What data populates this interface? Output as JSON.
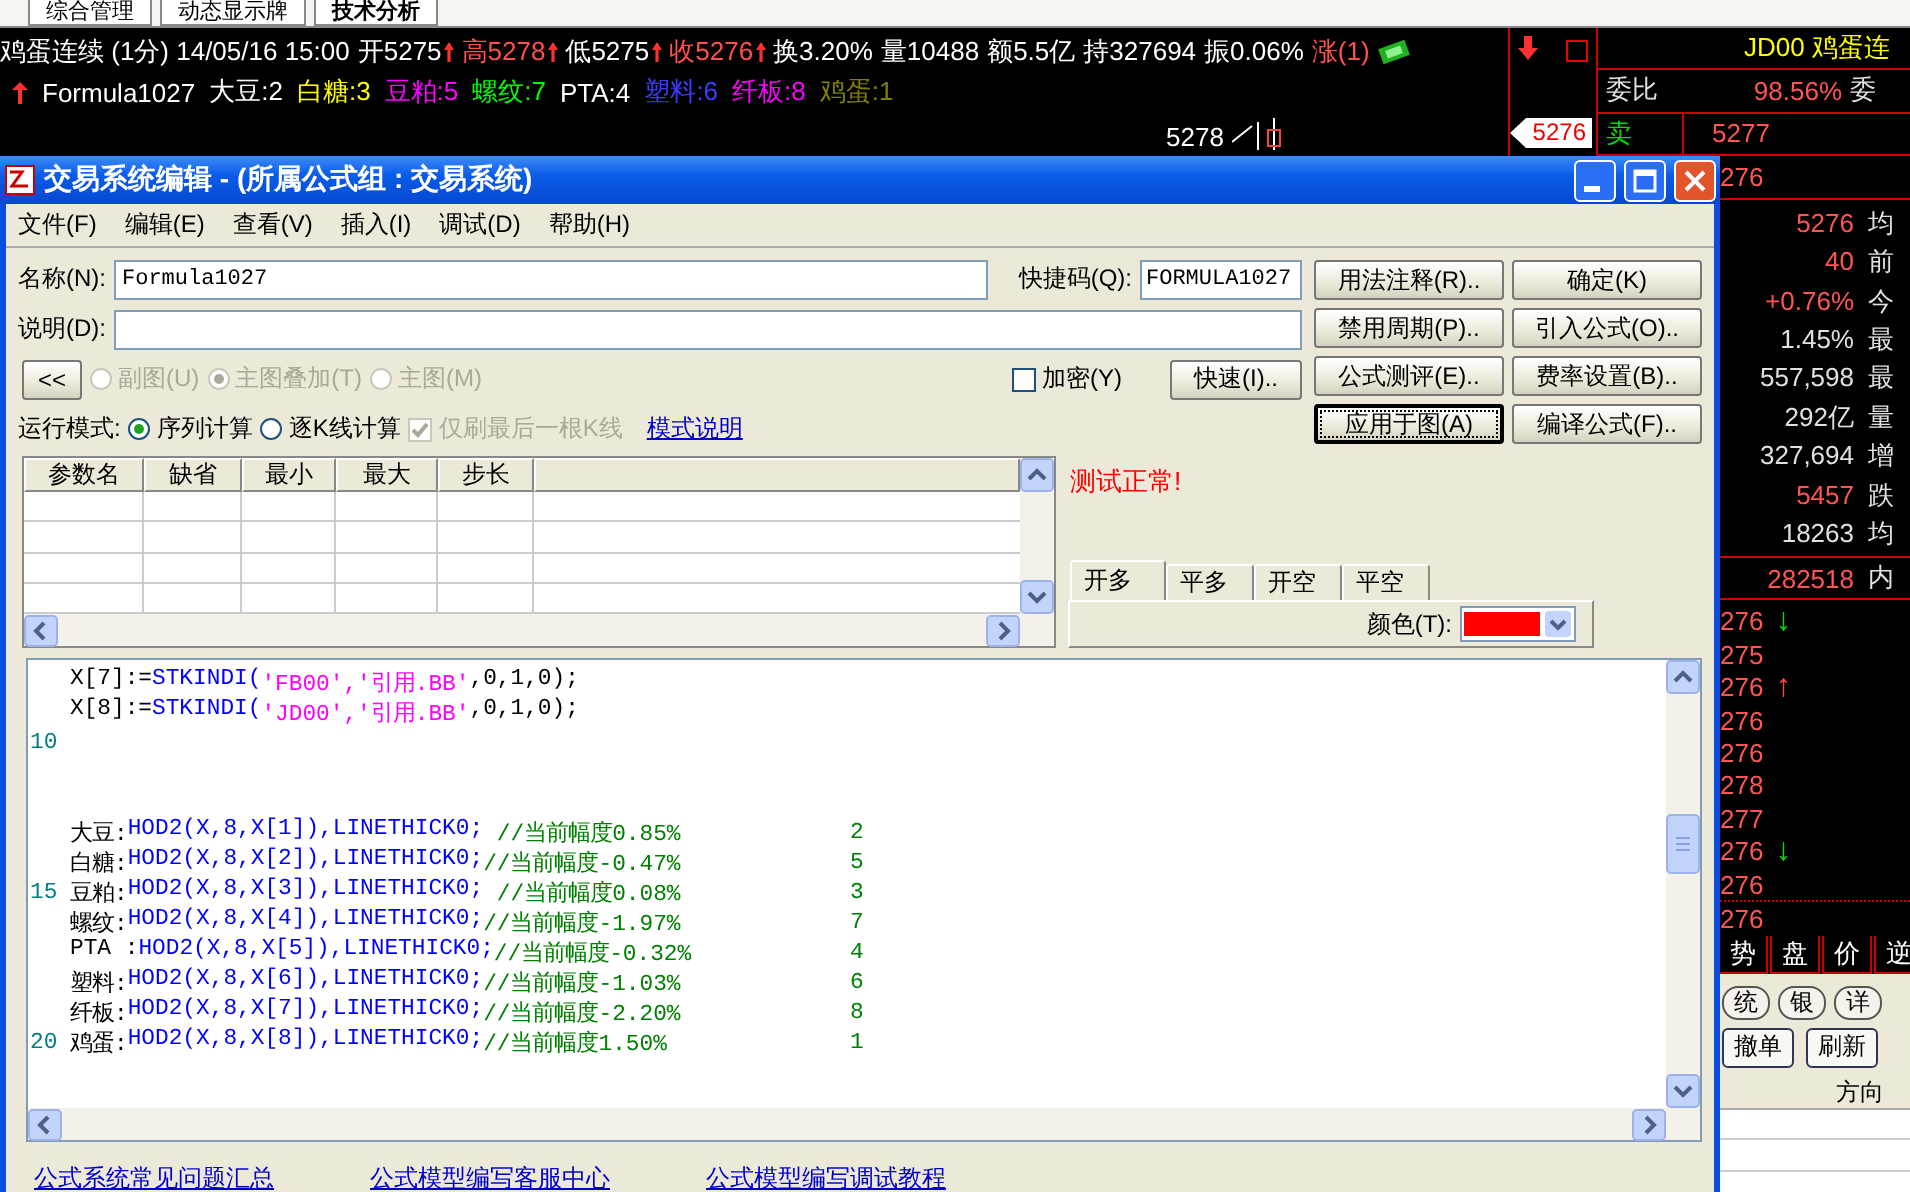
{
  "app_tabs": [
    {
      "label": "综合管理",
      "selected": false
    },
    {
      "label": "动态显示牌",
      "selected": false
    },
    {
      "label": "技术分析",
      "selected": true
    }
  ],
  "quote_line": [
    {
      "text": "鸡蛋连续 (1分) 14/05/16 15:00",
      "color": "#ffffff",
      "marker": false
    },
    {
      "text": "开5275",
      "color": "#ffffff",
      "marker": true
    },
    {
      "text": "高5278",
      "color": "#ff5050",
      "marker": true
    },
    {
      "text": "低5275",
      "color": "#ffffff",
      "marker": true
    },
    {
      "text": "收5276",
      "color": "#ff5050",
      "marker": true
    },
    {
      "text": "换3.20%",
      "color": "#ffffff",
      "marker": false
    },
    {
      "text": "量10488",
      "color": "#ffffff",
      "marker": false
    },
    {
      "text": "额5.5亿",
      "color": "#ffffff",
      "marker": false
    },
    {
      "text": "持327694",
      "color": "#ffffff",
      "marker": false
    },
    {
      "text": "振0.06%",
      "color": "#ffffff",
      "marker": false
    },
    {
      "text": "涨(1)",
      "color": "#ff5050",
      "marker": false
    }
  ],
  "legend": {
    "formula": "Formula1027",
    "items": [
      {
        "text": "大豆:2",
        "color": "#ffffff"
      },
      {
        "text": "白糖:3",
        "color": "#ffff00"
      },
      {
        "text": "豆粕:5",
        "color": "#ff00ff"
      },
      {
        "text": "螺纹:7",
        "color": "#00ff00"
      },
      {
        "text": "PTA:4",
        "color": "#ffffff"
      },
      {
        "text": "塑料:6",
        "color": "#3c3cff"
      },
      {
        "text": "纤板:8",
        "color": "#ff00ff"
      },
      {
        "text": "鸡蛋:1",
        "color": "#808000"
      }
    ]
  },
  "chart": {
    "price_label": "5278",
    "axis_tag": "5276"
  },
  "side_panel": {
    "code": "JD00",
    "name": "鸡蛋连",
    "ratio": {
      "label": "委比",
      "value": "98.56%",
      "label2": "委"
    },
    "ask": {
      "label": "卖",
      "value": "5277"
    },
    "price": "276",
    "stat_values": [
      {
        "value": "5276",
        "color": "#ff5555"
      },
      {
        "value": "40",
        "color": "#ff5555"
      },
      {
        "value": "+0.76%",
        "color": "#ff5555"
      },
      {
        "value": "1.45%",
        "color": "#e0e0e0"
      },
      {
        "value": "557,598",
        "color": "#e0e0e0"
      },
      {
        "value": "292亿",
        "color": "#e0e0e0"
      },
      {
        "value": "327,694",
        "color": "#e0e0e0"
      },
      {
        "value": "5457",
        "color": "#ff5555"
      },
      {
        "value": "18263",
        "color": "#e0e0e0"
      }
    ],
    "stat_labels": [
      "均",
      "前",
      "今",
      "最",
      "最",
      "量",
      "增",
      "跌",
      "均"
    ],
    "inner": {
      "value": "282518",
      "label": "内"
    },
    "ticks": [
      {
        "price": "276",
        "arrow": {
          "text": "↓",
          "color": "#00dd00"
        }
      },
      {
        "price": "275"
      },
      {
        "price": "276",
        "arrow": {
          "text": "↑",
          "color": "#ff4040"
        }
      },
      {
        "price": "276"
      },
      {
        "price": "276"
      },
      {
        "price": "278"
      },
      {
        "price": "277"
      },
      {
        "price": "276",
        "arrow": {
          "text": "↓",
          "color": "#00dd00"
        }
      },
      {
        "price": "276"
      },
      {
        "price": "276"
      }
    ],
    "tabs": [
      "势",
      "盘",
      "价",
      "逆"
    ],
    "subtabs": [
      "统",
      "银",
      "详"
    ],
    "buttons": [
      "撤单",
      "刷新"
    ],
    "table_columns": [
      "方向"
    ]
  },
  "dialog": {
    "title": "交易系统编辑 - (所属公式组 : 交易系统)",
    "menu": [
      "文件(F)",
      "编辑(E)",
      "查看(V)",
      "插入(I)",
      "调试(D)",
      "帮助(H)"
    ],
    "name_field": {
      "label": "名称(N):",
      "value": "Formula1027"
    },
    "shortcut_field": {
      "label": "快捷码(Q):",
      "value": "FORMULA1027"
    },
    "desc_field": {
      "label": "说明(D):"
    },
    "collapse_button": "<<",
    "chart_type_disabled": true,
    "chart_type": [
      {
        "label": "副图(U)",
        "selected": false
      },
      {
        "label": "主图叠加(T)",
        "selected": true
      },
      {
        "label": "主图(M)",
        "selected": false
      }
    ],
    "encrypt": {
      "label": "加密(Y)",
      "checked": false
    },
    "fast_button": "快速(I)..",
    "run_mode": {
      "label": "运行模式:",
      "options": [
        {
          "label": "序列计算",
          "selected": true
        },
        {
          "label": "逐K线计算",
          "selected": false
        }
      ],
      "refresh_last": {
        "label": "仅刷最后一根K线",
        "checked": true,
        "disabled": true
      },
      "link": "模式说明"
    },
    "buttons": [
      {
        "label": "用法注释(R)..",
        "focused": false
      },
      {
        "label": "确定(K)",
        "focused": false
      },
      {
        "label": "禁用周期(P)..",
        "focused": false
      },
      {
        "label": "引入公式(O)..",
        "focused": false
      },
      {
        "label": "公式测评(E)..",
        "focused": false
      },
      {
        "label": "费率设置(B)..",
        "focused": false
      },
      {
        "label": "应用于图(A)",
        "focused": true
      },
      {
        "label": "编译公式(F)..",
        "focused": false
      }
    ],
    "param_columns": [
      "参数名",
      "缺省",
      "最小",
      "最大",
      "步长"
    ],
    "status": "测试正常!",
    "signal_tabs": [
      {
        "label": "开多",
        "selected": true
      },
      {
        "label": "平多",
        "selected": false
      },
      {
        "label": "开空",
        "selected": false
      },
      {
        "label": "平空",
        "selected": false
      }
    ],
    "color_field": {
      "label": "颜色(T):",
      "color": "#ff0000"
    },
    "code_lines": [
      {
        "kind": "code",
        "segments": [
          {
            "kind": "plain",
            "text": "X[7]:="
          },
          {
            "kind": "function",
            "text": "STKINDI("
          },
          {
            "kind": "string",
            "text": "'FB00','引用.BB'"
          },
          {
            "kind": "plain",
            "text": ",0,1,0);"
          }
        ]
      },
      {
        "kind": "code",
        "segments": [
          {
            "kind": "plain",
            "text": "X[8]:="
          },
          {
            "kind": "function",
            "text": "STKINDI("
          },
          {
            "kind": "string",
            "text": "'JD00','引用.BB'"
          },
          {
            "kind": "plain",
            "text": ",0,1,0);"
          }
        ]
      },
      {
        "kind": "blank",
        "number": "10"
      },
      {
        "kind": "blank"
      },
      {
        "kind": "blank"
      },
      {
        "kind": "code",
        "segments": [
          {
            "kind": "plain",
            "text": "大豆:"
          },
          {
            "kind": "function",
            "text": "HOD2(X,8,X[1]),LINETHICK0;"
          },
          {
            "kind": "comment",
            "text": " //当前幅度0.85%"
          }
        ],
        "note": "2"
      },
      {
        "kind": "code",
        "segments": [
          {
            "kind": "plain",
            "text": "白糖:"
          },
          {
            "kind": "function",
            "text": "HOD2(X,8,X[2]),LINETHICK0;"
          },
          {
            "kind": "comment",
            "text": "//当前幅度-0.47%"
          }
        ],
        "note": "5"
      },
      {
        "kind": "code",
        "number": "15",
        "segments": [
          {
            "kind": "plain",
            "text": "豆粕:"
          },
          {
            "kind": "function",
            "text": "HOD2(X,8,X[3]),LINETHICK0;"
          },
          {
            "kind": "comment",
            "text": " //当前幅度0.08%"
          }
        ],
        "note": "3"
      },
      {
        "kind": "code",
        "segments": [
          {
            "kind": "plain",
            "text": "螺纹:"
          },
          {
            "kind": "function",
            "text": "HOD2(X,8,X[4]),LINETHICK0;"
          },
          {
            "kind": "comment",
            "text": "//当前幅度-1.97%"
          }
        ],
        "note": "7"
      },
      {
        "kind": "code",
        "segments": [
          {
            "kind": "plain",
            "text": "PTA :"
          },
          {
            "kind": "function",
            "text": "HOD2(X,8,X[5]),LINETHICK0;"
          },
          {
            "kind": "comment",
            "text": "//当前幅度-0.32%"
          }
        ],
        "note": "4"
      },
      {
        "kind": "code",
        "segments": [
          {
            "kind": "plain",
            "text": "塑料:"
          },
          {
            "kind": "function",
            "text": "HOD2(X,8,X[6]),LINETHICK0;"
          },
          {
            "kind": "comment",
            "text": "//当前幅度-1.03%"
          }
        ],
        "note": "6"
      },
      {
        "kind": "code",
        "segments": [
          {
            "kind": "plain",
            "text": "纤板:"
          },
          {
            "kind": "function",
            "text": "HOD2(X,8,X[7]),LINETHICK0;"
          },
          {
            "kind": "comment",
            "text": "//当前幅度-2.20%"
          }
        ],
        "note": "8"
      },
      {
        "kind": "code",
        "number": "20",
        "segments": [
          {
            "kind": "plain",
            "text": "鸡蛋:"
          },
          {
            "kind": "function",
            "text": "HOD2(X,8,X[8]),LINETHICK0;"
          },
          {
            "kind": "comment",
            "text": "//当前幅度1.50%"
          }
        ],
        "note": "1"
      }
    ],
    "links": [
      "公式系统常见问题汇总",
      "公式模型编写客服中心",
      "公式模型编写调试教程"
    ]
  }
}
